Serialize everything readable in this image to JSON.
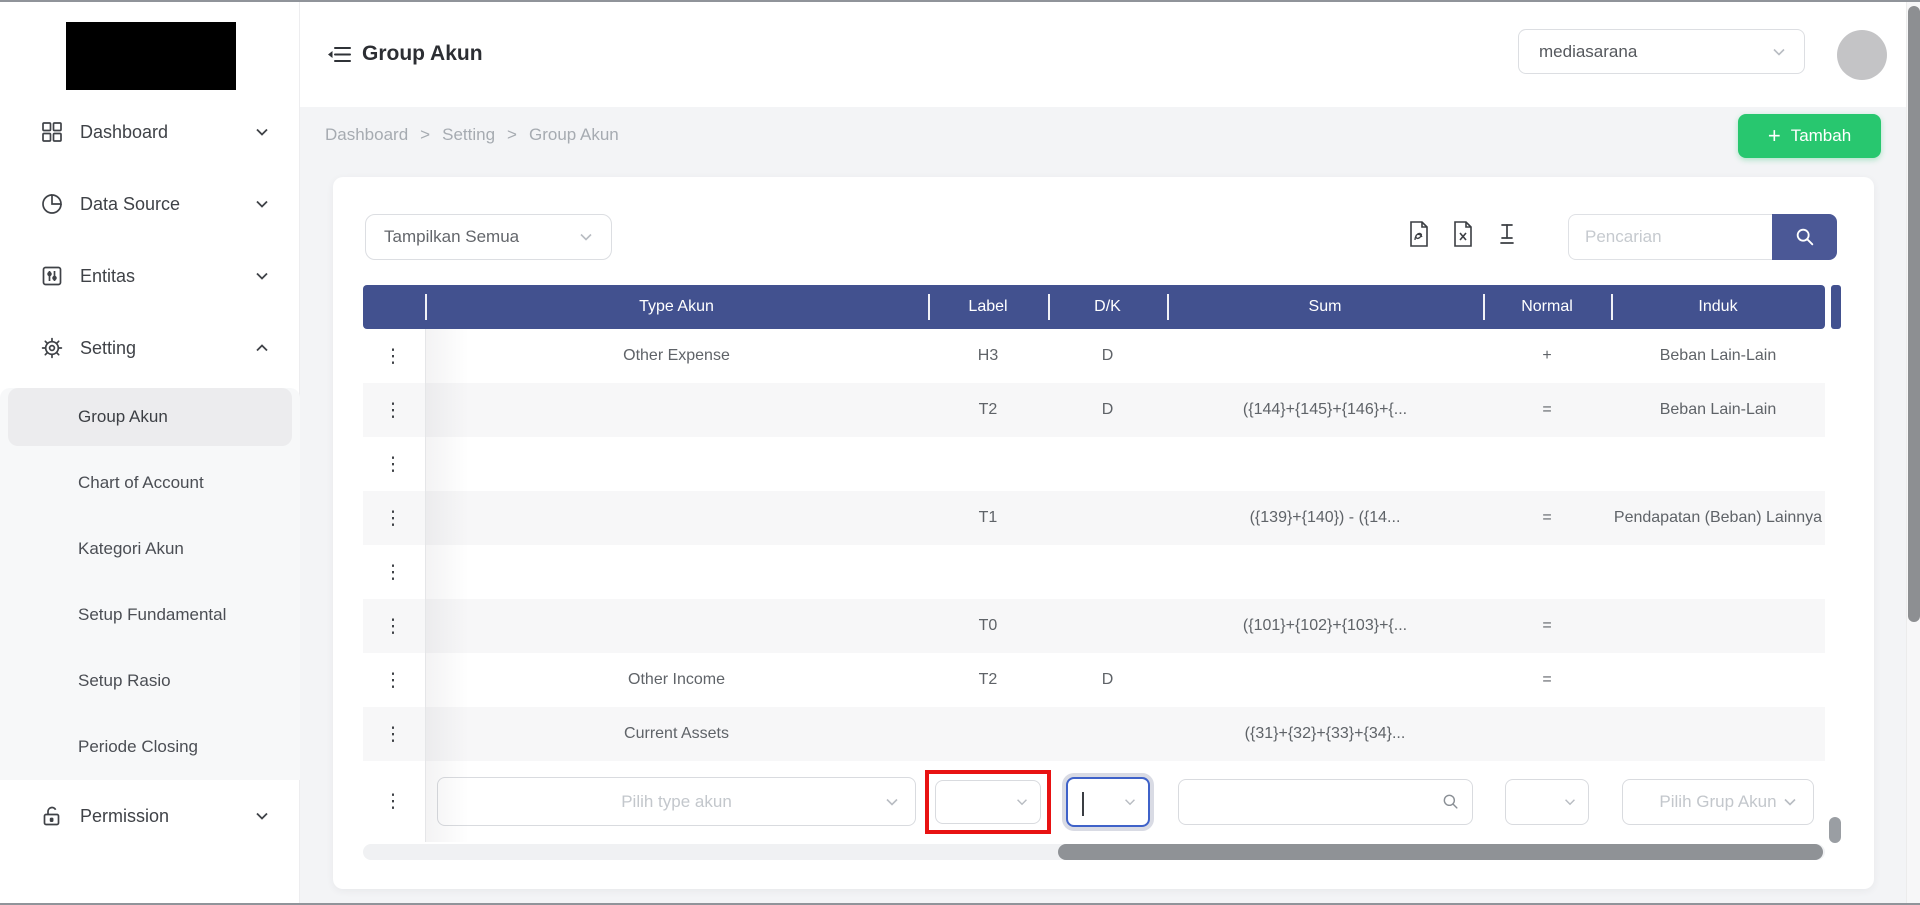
{
  "header": {
    "title": "Group Akun",
    "tenant_value": "mediasarana"
  },
  "breadcrumb": {
    "items": [
      "Dashboard",
      "Setting",
      "Group Akun"
    ],
    "separator": ">"
  },
  "actions": {
    "add_label": "Tambah",
    "add_plus": "+"
  },
  "sidebar": {
    "items": [
      {
        "label": "Dashboard"
      },
      {
        "label": "Data Source"
      },
      {
        "label": "Entitas"
      },
      {
        "label": "Setting"
      }
    ],
    "setting_children": [
      "Group Akun",
      "Chart of Account",
      "Kategori Akun",
      "Setup Fundamental",
      "Setup Rasio",
      "Periode Closing"
    ],
    "active_child": "Group Akun",
    "permission": {
      "label": "Permission"
    }
  },
  "toolbar": {
    "filter_value": "Tampilkan Semua",
    "search_placeholder": "Pencarian",
    "icons": [
      "pdf-export-icon",
      "excel-export-icon",
      "row-height-icon",
      "search-icon"
    ]
  },
  "table": {
    "columns": [
      "",
      "Type Akun",
      "Label",
      "D/K",
      "Sum",
      "Normal",
      "Induk"
    ],
    "rows": [
      {
        "type_akun": "Other Expense",
        "label": "H3",
        "dk": "D",
        "sum": "",
        "normal": "+",
        "induk": "Beban Lain-Lain"
      },
      {
        "type_akun": "",
        "label": "T2",
        "dk": "D",
        "sum": "({144}+{145}+{146}+{...",
        "normal": "=",
        "induk": "Beban Lain-Lain"
      },
      {
        "type_akun": "",
        "label": "",
        "dk": "",
        "sum": "",
        "normal": "",
        "induk": ""
      },
      {
        "type_akun": "",
        "label": "T1",
        "dk": "",
        "sum": "({139}+{140}) - ({14...",
        "normal": "=",
        "induk": "Pendapatan (Beban) Lainnya"
      },
      {
        "type_akun": "",
        "label": "",
        "dk": "",
        "sum": "",
        "normal": "",
        "induk": ""
      },
      {
        "type_akun": "",
        "label": "T0",
        "dk": "",
        "sum": "({101}+{102}+{103}+{...",
        "normal": "=",
        "induk": ""
      },
      {
        "type_akun": "Other Income",
        "label": "T2",
        "dk": "D",
        "sum": "",
        "normal": "=",
        "induk": ""
      },
      {
        "type_akun": "Current Assets",
        "label": "",
        "dk": "",
        "sum": "({31}+{32}+{33}+{34}...",
        "normal": "",
        "induk": ""
      }
    ],
    "row_menu_glyph": "⋮",
    "new_row": {
      "type_placeholder": "Pilih type akun",
      "induk_placeholder": "Pilih Grup Akun"
    }
  },
  "colors": {
    "primary": "#42518f",
    "primary_button": "#4b5896",
    "success": "#28c76f",
    "highlight_red": "#e81212",
    "focus_blue": "#3f62c9",
    "zebra_row": "#f7f7f8",
    "content_bg": "#f3f4f6"
  }
}
